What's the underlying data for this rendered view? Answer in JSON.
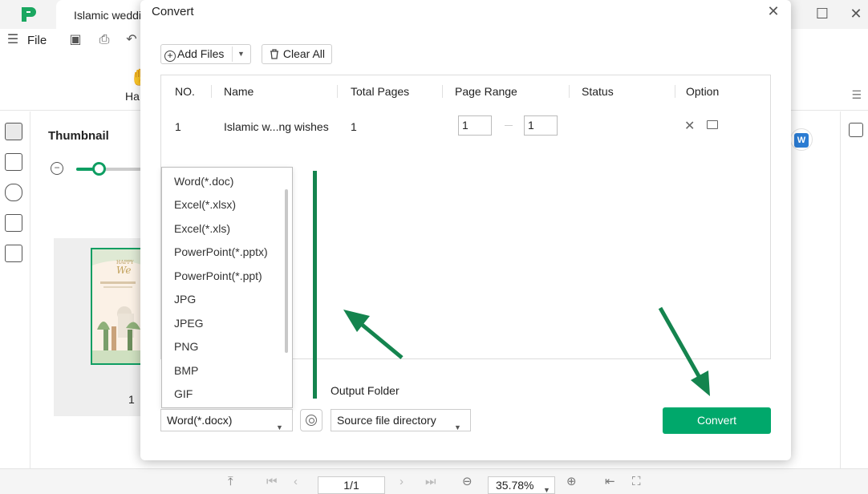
{
  "app": {
    "tab_title": "Islamic weddi",
    "file_menu": "File",
    "hand_tool_label": "Ha",
    "thumbnail_title": "Thumbnail",
    "thumbnail_page_number": "1",
    "thumbnail_zoom_fraction": 0.33,
    "accent_color": "#0e9e62"
  },
  "statusbar": {
    "page_indicator": "1/1",
    "zoom_level": "35.78%"
  },
  "dialog": {
    "title": "Convert",
    "add_files_label": "Add Files",
    "clear_all_label": "Clear All",
    "table": {
      "columns": [
        "NO.",
        "Name",
        "Total Pages",
        "Page Range",
        "Status",
        "Option"
      ],
      "rows": [
        {
          "no": "1",
          "name": "Islamic w...ng wishes",
          "total_pages": "1",
          "range_from": "1",
          "range_to": "1",
          "status": ""
        }
      ]
    },
    "format_options": [
      "Word(*.doc)",
      "Excel(*.xlsx)",
      "Excel(*.xls)",
      "PowerPoint(*.pptx)",
      "PowerPoint(*.ppt)",
      "JPG",
      "JPEG",
      "PNG",
      "BMP",
      "GIF"
    ],
    "selected_format": "Word(*.docx)",
    "output_folder_label": "Output Folder",
    "output_folder_value": "Source file directory",
    "convert_label": "Convert",
    "convert_color": "#00a86b",
    "annotation_color": "#14844e"
  }
}
